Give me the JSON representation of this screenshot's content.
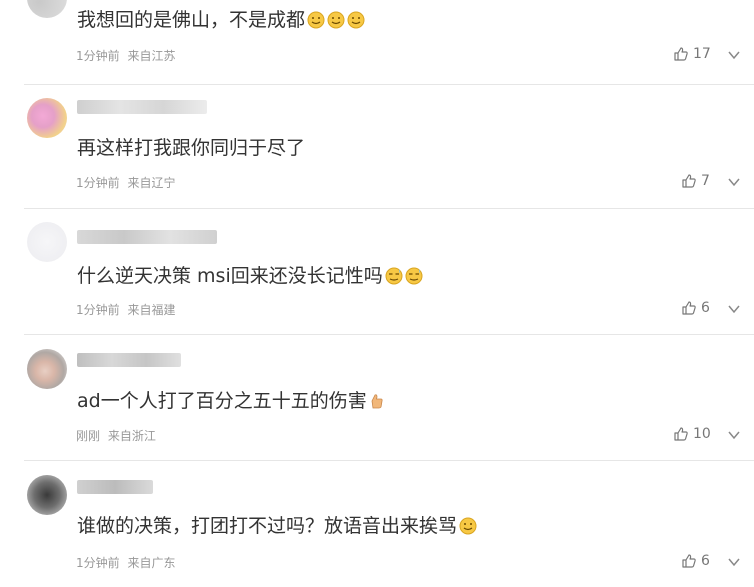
{
  "comments": [
    {
      "text": "我想回的是佛山，不是成都",
      "emoji": [
        "smile-emoji",
        "smile-emoji",
        "smile-emoji"
      ],
      "time": "1分钟前",
      "location": "来自江苏",
      "likes": "17"
    },
    {
      "text": "再这样打我跟你同归于尽了",
      "emoji": [],
      "time": "1分钟前",
      "location": "来自辽宁",
      "likes": "7"
    },
    {
      "text": "什么逆天决策 msi回来还没长记性吗",
      "emoji": [
        "sweat-emoji",
        "sweat-emoji"
      ],
      "time": "1分钟前",
      "location": "来自福建",
      "likes": "6"
    },
    {
      "text": "ad一个人打了百分之五十五的伤害",
      "emoji": [
        "thumbs-up-emoji"
      ],
      "time": "刚刚",
      "location": "来自浙江",
      "likes": "10"
    },
    {
      "text": "谁做的决策，打团打不过吗？放语音出来挨骂",
      "emoji": [
        "smile-emoji"
      ],
      "time": "1分钟前",
      "location": "来自广东",
      "likes": "6"
    }
  ],
  "colors": {
    "text": "#333333",
    "meta": "#999999",
    "divider": "#e6e6e6",
    "emoji_yellow": "#f7c844"
  }
}
